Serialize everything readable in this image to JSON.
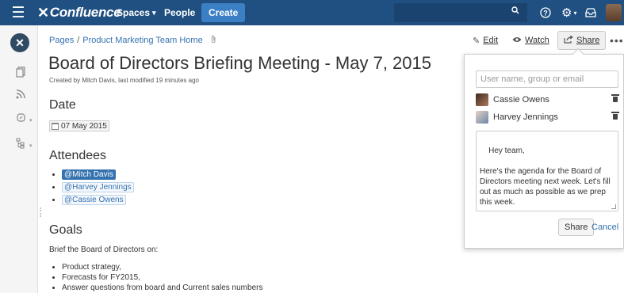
{
  "header": {
    "menu_icon": "hamburger-icon",
    "logo": "Confluence",
    "nav": {
      "spaces": "Spaces",
      "people": "People"
    },
    "create_label": "Create",
    "search_icon": "search-icon",
    "help_icon": "help-icon",
    "settings_icon": "gear-icon",
    "notifications_icon": "notification-icon",
    "dropdown_glyph": "▾"
  },
  "breadcrumb": {
    "items": [
      "Pages",
      "Product Marketing Team Home"
    ],
    "separator": "/"
  },
  "page": {
    "title": "Board of Directors Briefing Meeting - May 7, 2015",
    "byline": "Created by Mitch Davis, last modified 19 minutes ago",
    "date_heading": "Date",
    "date_value": "07 May 2015",
    "attendees_heading": "Attendees",
    "attendees": [
      "@Mitch Davis",
      "@Harvey Jennings",
      "@Cassie Owens"
    ],
    "goals_heading": "Goals",
    "goals_intro": "Brief the Board of Directors on:",
    "goals": [
      "Product strategy,",
      " Forecasts for FY2015,",
      "Answer questions from board and Current sales numbers"
    ]
  },
  "actions": {
    "edit_label": "Edit",
    "watch_label": "Watch",
    "share_label": "Share",
    "more_label": "•••"
  },
  "share_dialog": {
    "input_placeholder": "User name, group or email",
    "recipients": [
      "Cassie Owens",
      "Harvey Jennings"
    ],
    "message": "Hey team,\n\nHere's the agenda for the Board of Directors meeting next week. Let's fill out as much as possible as we prep this week.",
    "share_button": "Share",
    "cancel_link": "Cancel"
  },
  "colors": {
    "header_bg": "#205081",
    "create_bg": "#3b7fc4",
    "link": "#3572b0"
  }
}
